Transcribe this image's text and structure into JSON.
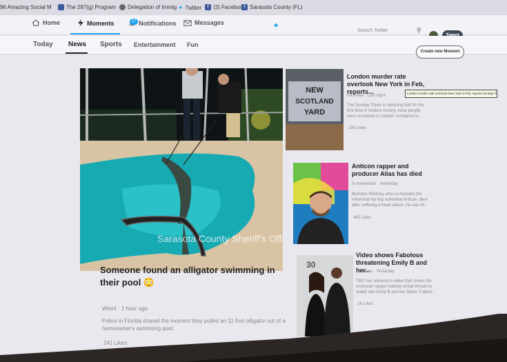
{
  "bookmarks": [
    {
      "label": "96 Amazing Social M",
      "color": "#c33"
    },
    {
      "label": "The 287(g) Program",
      "color": "#3a5a9a"
    },
    {
      "label": "Delegation of Immig",
      "color": "#555"
    },
    {
      "label": "Twitter",
      "color": "#1da1f2"
    },
    {
      "label": "(3) Facebook",
      "color": "#3b5998"
    },
    {
      "label": "Sarasota County (FL)",
      "color": "#3b5998"
    }
  ],
  "nav": {
    "home": "Home",
    "moments": "Moments",
    "notifications": "Notifications",
    "notifications_badge": "27",
    "messages": "Messages",
    "search_placeholder": "Search Twitter",
    "tweet_button": "Tweet"
  },
  "tabs": [
    "Today",
    "News",
    "Sports",
    "Entertainment",
    "Fun"
  ],
  "create_moment": "Create new Moment",
  "main_article": {
    "image_watermark": "Sarasota County Sheriff's Office",
    "title": "Someone found an alligator swimming in their pool 😳",
    "meta": "Weird · 1 hour ago",
    "body": "Police in Florida shared the moment they pulled an 11-foot alligator out of a homeowner's swimming pool.",
    "likes": "241 Likes"
  },
  "side_articles": [
    {
      "image_sign_lines": [
        "NEW",
        "SCOTLAND",
        "YARD"
      ],
      "title": "London murder rate overtook New York in Feb, reports...",
      "meta": "UK news · Last night",
      "body": "The Sunday Times is reporting that for the first time in modern history, more people were murdered in London compared to...",
      "likes": "190 Likes",
      "tooltip": "London murder rate overtook New York in Feb, reports Sunday Times"
    },
    {
      "title": "Anticon rapper and producer Alias has died",
      "meta": "In memoriam · Yesterday",
      "body": "Brendon Whitney, who co-founded the influential hip hop collective Anticon, died after suffering a heart attack. He was 41.",
      "likes": "465 Likes"
    },
    {
      "image_text": "30",
      "title": "Video shows Fabolous threatening Emily B and her...",
      "meta": "US news · Yesterday",
      "body": "TMZ has released a video that shows the American rapper making verbal threats to reality star Emily B and her father. Fabolo...",
      "likes": "1K Likes"
    }
  ]
}
